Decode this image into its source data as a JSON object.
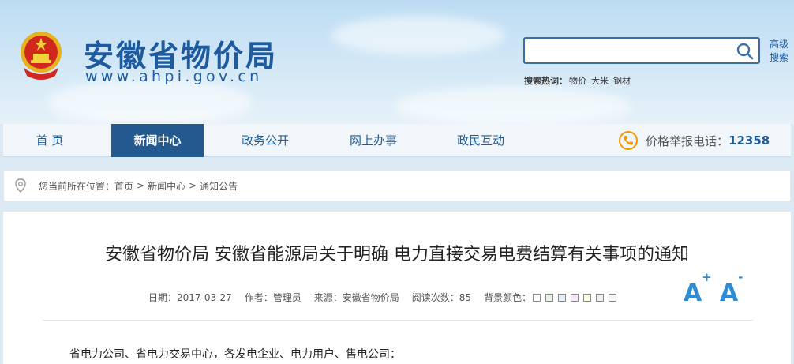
{
  "header": {
    "site_name": "安徽省物价局",
    "site_url": "www.ahpi.gov.cn",
    "search": {
      "value": "",
      "placeholder": "",
      "advanced_label": "高级搜索",
      "hot_label": "搜索热词：",
      "hot_words": [
        "物价",
        "大米",
        "钢材"
      ]
    }
  },
  "nav": {
    "items": [
      {
        "label": "首 页"
      },
      {
        "label": "新闻中心"
      },
      {
        "label": "政务公开"
      },
      {
        "label": "网上办事"
      },
      {
        "label": "政民互动"
      }
    ],
    "active_index": 1,
    "phone_label": "价格举报电话：",
    "phone_number": "12358"
  },
  "breadcrumb": {
    "prefix": "您当前所在位置：",
    "items": [
      "首页",
      "新闻中心",
      "通知公告"
    ],
    "separator": ">"
  },
  "article": {
    "title": "安徽省物价局 安徽省能源局关于明确 电力直接交易电费结算有关事项的通知",
    "meta": {
      "date": "日期：2017-03-27",
      "author": "作者：管理员",
      "source": "来源：安徽省物价局",
      "views": "阅读次数：85",
      "bg_label": "背景颜色："
    },
    "bg_colors": [
      "#ffffff",
      "#e6f3e6",
      "#e3f0fa",
      "#f7e6f7",
      "#fbfbe0",
      "#eeeeee",
      "#f5f5f5"
    ],
    "font_increase": "A",
    "font_decrease": "A",
    "font_increase_sign": "+",
    "font_decrease_sign": "-",
    "body_first_line": "省电力公司、省电力交易中心，各发电企业、电力用户、售电公司："
  },
  "colors": {
    "brand": "#1e5a9e",
    "nav_active": "#23598f",
    "accent_orange": "#f39800",
    "font_btn": "#2d8cd6"
  }
}
